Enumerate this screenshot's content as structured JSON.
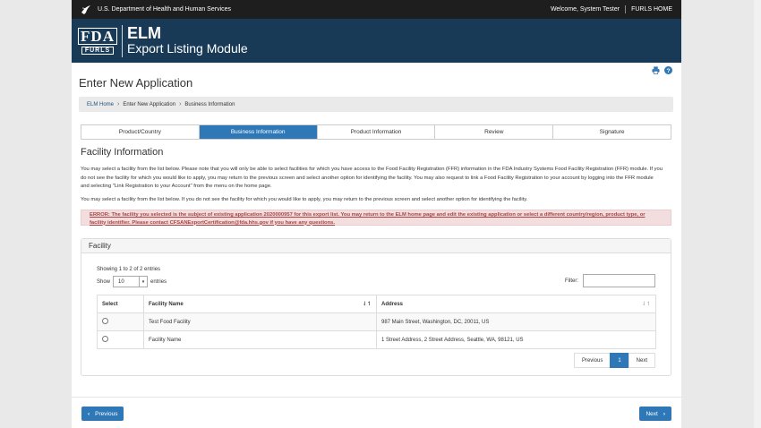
{
  "gov_bar": {
    "agency": "U.S. Department of Health and Human Services",
    "welcome": "Welcome, System Tester",
    "home_link": "FURLS HOME"
  },
  "brand": {
    "logo_top": "FDA",
    "logo_bottom": "FURLS",
    "title_line1": "ELM",
    "title_line2": "Export Listing Module"
  },
  "page_title": "Enter New Application",
  "breadcrumb": {
    "home": "ELM Home",
    "step1": "Enter New Application",
    "current": "Business Information"
  },
  "steps": [
    {
      "label": "Product/Country"
    },
    {
      "label": "Business Information"
    },
    {
      "label": "Product Information"
    },
    {
      "label": "Review"
    },
    {
      "label": "Signature"
    }
  ],
  "active_step": "Business Information",
  "section_title": "Facility Information",
  "para1": "You may select a facility from the list below. Please note that you will only be able to select facilities for which you have access to the Food Facility Registration (FFR) information in the FDA Industry Systems Food Facility Registration (FFR) module. If you do not see the facility for which you would like to apply, you may return to the previous screen and select another option for identifying the facility. You may also request to link a Food Facility Registration to your account by logging into the FFR module and selecting \"Link Registration to your Account\" from the menu on the home page.",
  "para2": "You may select a facility from the list below. If you do not see the facility for which you would like to apply, you may return to the previous screen and select another option for identifying the facility.",
  "error": "ERROR: The facility you selected is the subject of existing application 2020000957 for this export list. You may return to the ELM home page and edit the existing application or select a different country/region, product type, or facility identifier. Please contact CFSANExportCertification@fda.hhs.gov if you have any questions.",
  "panel": {
    "title": "Facility",
    "showing": "Showing 1 to 2 of 2 entries",
    "show_label": "Show",
    "page_len": "10",
    "entries_label": "entries",
    "filter_label": "Filter:",
    "columns": [
      "Select",
      "Facility Name",
      "Address"
    ],
    "rows": [
      {
        "name": "Test Food Facility",
        "address": "987 Main Street, Washington, DC, 20011, US"
      },
      {
        "name": "Facility Name",
        "address": "1 Street Address, 2 Street Address, Seattle, WA, 98121, US"
      }
    ],
    "pager": {
      "prev": "Previous",
      "page": "1",
      "next": "Next"
    }
  },
  "buttons": {
    "previous": "Previous",
    "next": "Next"
  },
  "colors": {
    "header_bg": "#183a56",
    "accent": "#2f78b7",
    "error_bg": "#f2dede"
  }
}
